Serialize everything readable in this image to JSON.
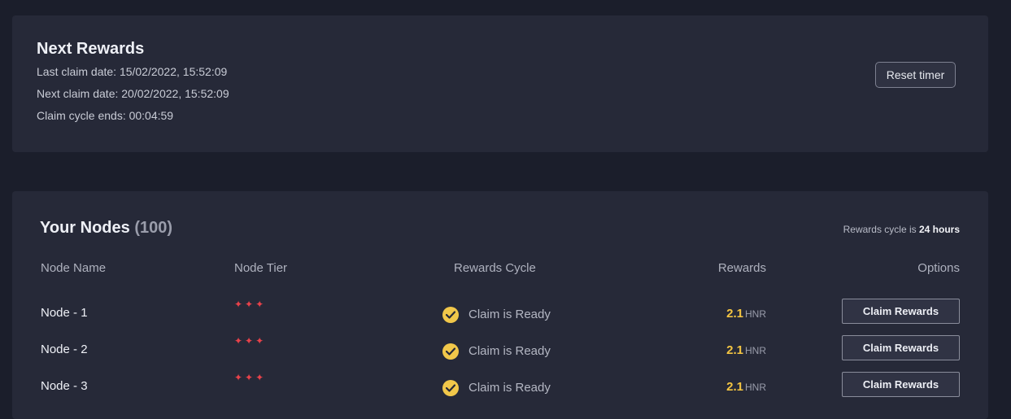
{
  "next_rewards": {
    "title": "Next Rewards",
    "last_claim": "Last claim date: 15/02/2022, 15:52:09",
    "next_claim": "Next claim date: 20/02/2022, 15:52:09",
    "cycle_ends": "Claim cycle ends: 00:04:59",
    "reset_label": "Reset timer"
  },
  "nodes": {
    "title": "Your Nodes",
    "count": "(100)",
    "cycle_note_prefix": "Rewards cycle is",
    "cycle_note_value": "24 hours",
    "columns": [
      "Node Name",
      "Node Tier",
      "Rewards Cycle",
      "Rewards",
      "Options"
    ],
    "rows": [
      {
        "name": "Node - 1",
        "tier": "✦✦✦",
        "status": "Claim is Ready",
        "amount": "2.1",
        "unit": "HNR",
        "action": "Claim Rewards"
      },
      {
        "name": "Node - 2",
        "tier": "✦✦✦",
        "status": "Claim is Ready",
        "amount": "2.1",
        "unit": "HNR",
        "action": "Claim Rewards"
      },
      {
        "name": "Node - 3",
        "tier": "✦✦✦",
        "status": "Claim is Ready",
        "amount": "2.1",
        "unit": "HNR",
        "action": "Claim Rewards"
      }
    ]
  },
  "colors": {
    "background": "#1b1e2b",
    "card": "#262938",
    "accent_yellow": "#f4c542",
    "tier_red": "#e8424a"
  },
  "icons": {
    "tier": "star-icon",
    "status": "check-circle-icon"
  }
}
